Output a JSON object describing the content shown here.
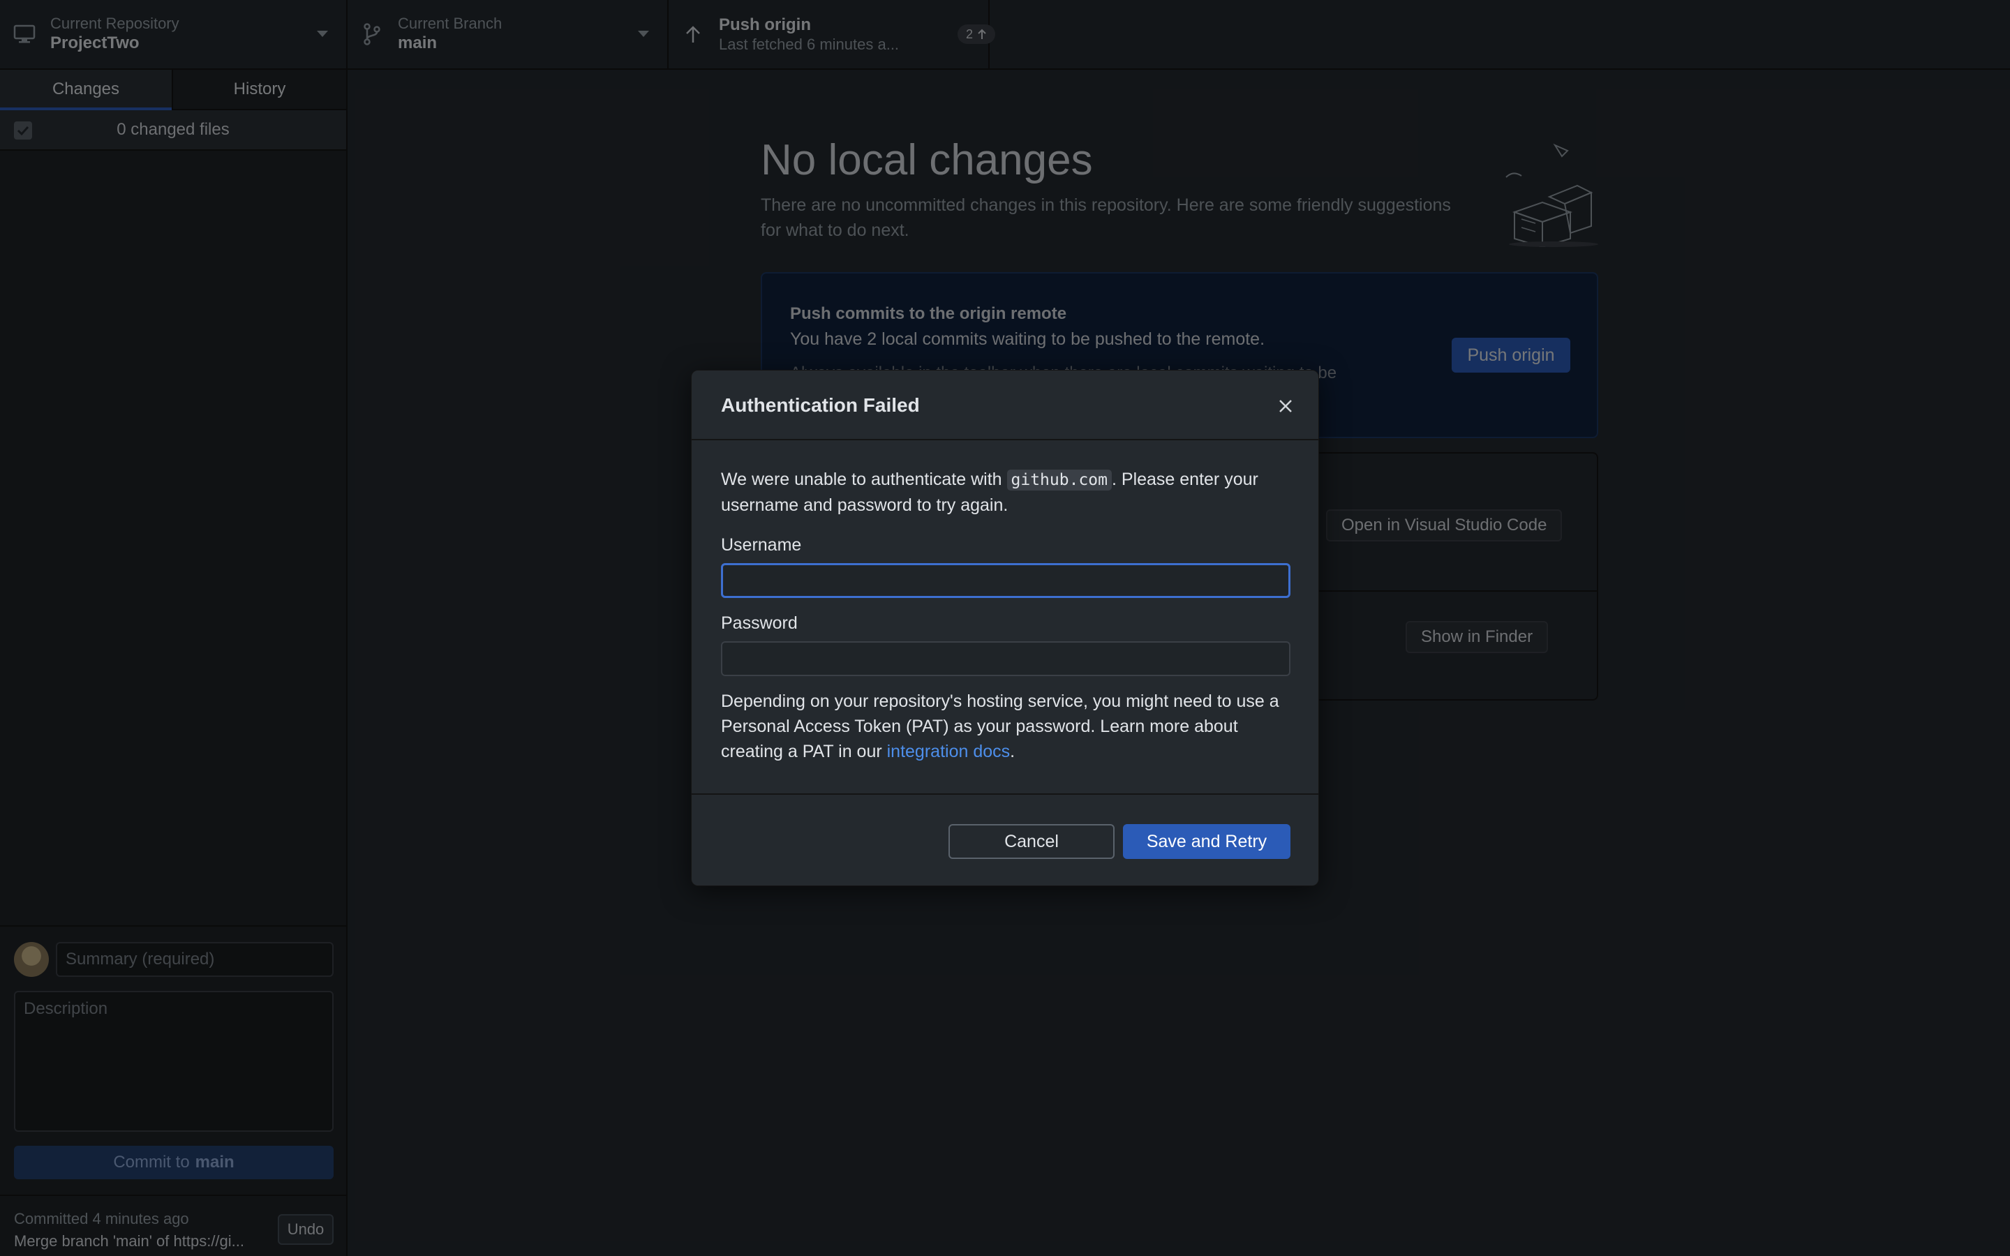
{
  "toolbar": {
    "repo": {
      "label": "Current Repository",
      "value": "ProjectTwo",
      "icon": "monitor-icon"
    },
    "branch": {
      "label": "Current Branch",
      "value": "main",
      "icon": "branch-icon"
    },
    "push": {
      "label": "Push origin",
      "sub": "Last fetched 6 minutes a...",
      "badge": "2",
      "icon": "arrow-up-icon"
    }
  },
  "sidebar": {
    "tabs": [
      {
        "label": "Changes"
      },
      {
        "label": "History"
      }
    ],
    "changed_files": "0 changed files",
    "summary_placeholder": "Summary (required)",
    "description_placeholder": "Description",
    "commit_prefix": "Commit to",
    "commit_branch": "main",
    "last_commit": {
      "time": "Committed 4 minutes ago",
      "message": "Merge branch 'main' of https://gi...",
      "undo": "Undo"
    }
  },
  "main": {
    "title": "No local changes",
    "subtitle": "There are no uncommitted changes in this repository. Here are some friendly suggestions for what to do next.",
    "push_card": {
      "title": "Push commits to the origin remote",
      "desc": "You have 2 local commits waiting to be pushed to the remote.",
      "hint": "Always available in the toolbar when there are local commits waiting to be",
      "button": "Push origin"
    },
    "editor_button": "Open in Visual Studio Code",
    "finder_button": "Show in Finder"
  },
  "dialog": {
    "title": "Authentication Failed",
    "msg_before": "We were unable to authenticate with ",
    "msg_host": "github.com",
    "msg_after": ". Please enter your username and password to try again.",
    "username_label": "Username",
    "username_value": "",
    "password_label": "Password",
    "password_value": "",
    "note_before": "Depending on your repository's hosting service, you might need to use a Personal Access Token (PAT) as your password. Learn more about creating a PAT in our ",
    "note_link": "integration docs",
    "note_after": ".",
    "cancel": "Cancel",
    "save": "Save and Retry"
  },
  "colors": {
    "accent": "#2b5bb7",
    "focus": "#3d6fd0",
    "link": "#4d8eea"
  }
}
